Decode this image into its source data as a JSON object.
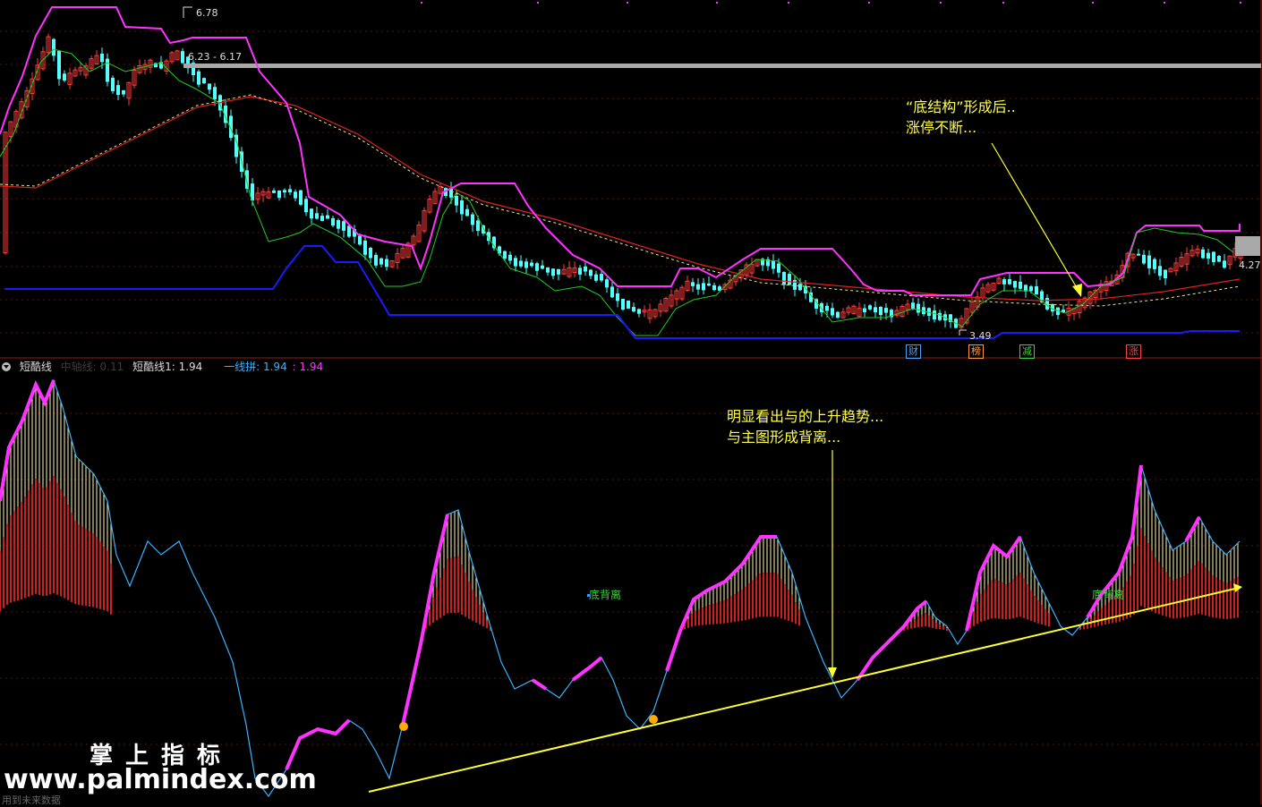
{
  "main_chart": {
    "price_high_label": "6.78",
    "price_range_label": "6.23 - 6.17",
    "price_low_label": "3.49",
    "current_price_label": "4.27",
    "annotation_top": [
      "“底结构”形成后..",
      "涨停不断..."
    ],
    "badges": [
      {
        "text": "财",
        "color": "#4aa3ff"
      },
      {
        "text": "榜",
        "color": "#ff9a3c"
      },
      {
        "text": "减",
        "color": "#3cd23c"
      },
      {
        "text": "涨",
        "color": "#ff4040"
      }
    ]
  },
  "indicator": {
    "title": "短酷线",
    "faded_label": "中轴线: 0.11",
    "line1_label": "短酷线1: 1.94",
    "line2_label": "一线拼: 1.94",
    "line2_extra": ": 1.94",
    "signal_labels": [
      "底背离",
      "底背离"
    ],
    "annotation": [
      "明显看出与的上升趋势...",
      "与主图形成背离..."
    ]
  },
  "watermark": {
    "title": "掌上指标",
    "url": "www.palmindex.com"
  },
  "footer_note": "用到未来数据",
  "colors": {
    "up_candle": "#ff3c3c",
    "down_candle": "#54ffff",
    "envelope": "#ff33ff",
    "support_line": "#1a1aff",
    "green_band": "#22cc22",
    "trend_line": "#ffff33",
    "osc_line": "#39b3ff"
  }
}
